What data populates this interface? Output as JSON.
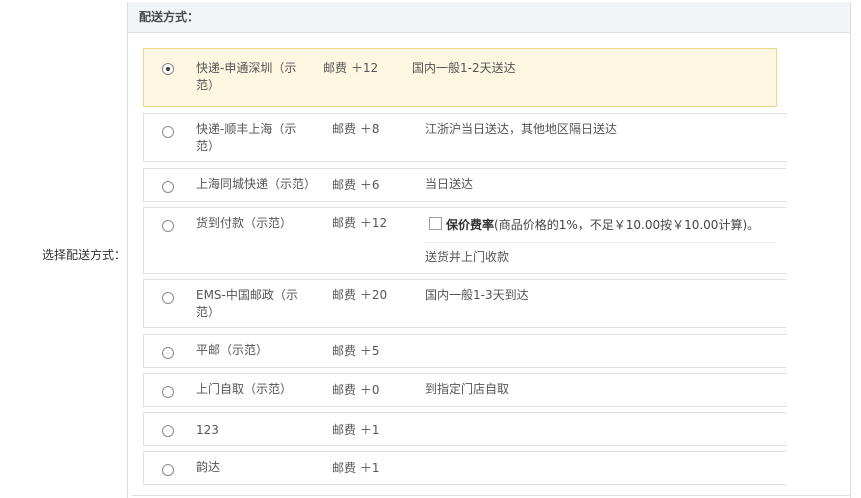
{
  "form": {
    "label": "选择配送方式："
  },
  "panel": {
    "title": "配送方式："
  },
  "shipping_options": [
    {
      "name_line1": "快递-申通深圳（示",
      "name_line2": "范）",
      "fee": "邮费 ＋12",
      "desc": "国内一般1-2天送达",
      "selected": true
    },
    {
      "name_line1": "快递-顺丰上海（示",
      "name_line2": "范）",
      "fee": "邮费 ＋8",
      "desc": "江浙沪当日送达，其他地区隔日送达",
      "selected": false
    },
    {
      "name_line1": "上海同城快递（示范）",
      "name_line2": "",
      "fee": "邮费 ＋6",
      "desc": "当日送达",
      "selected": false
    },
    {
      "name_line1": "货到付款（示范）",
      "name_line2": "",
      "fee": "邮费 ＋12",
      "desc": "送货并上门收款",
      "selected": false
    },
    {
      "name_line1": "EMS-中国邮政（示",
      "name_line2": "范）",
      "fee": "邮费 ＋20",
      "desc": "国内一般1-3天到达",
      "selected": false
    },
    {
      "name_line1": "平邮（示范）",
      "name_line2": "",
      "fee": "邮费 ＋5",
      "desc": "",
      "selected": false
    },
    {
      "name_line1": "上门自取（示范）",
      "name_line2": "",
      "fee": "邮费 ＋0",
      "desc": "到指定门店自取",
      "selected": false
    },
    {
      "name_line1": "123",
      "name_line2": "",
      "fee": "邮费 ＋1",
      "desc": "",
      "selected": false
    },
    {
      "name_line1": "韵达",
      "name_line2": "",
      "fee": "邮费 ＋1",
      "desc": "",
      "selected": false
    }
  ],
  "insurance": {
    "label": "保价费率",
    "text": "(商品价格的1%，不足￥10.00按￥10.00计算)。"
  }
}
